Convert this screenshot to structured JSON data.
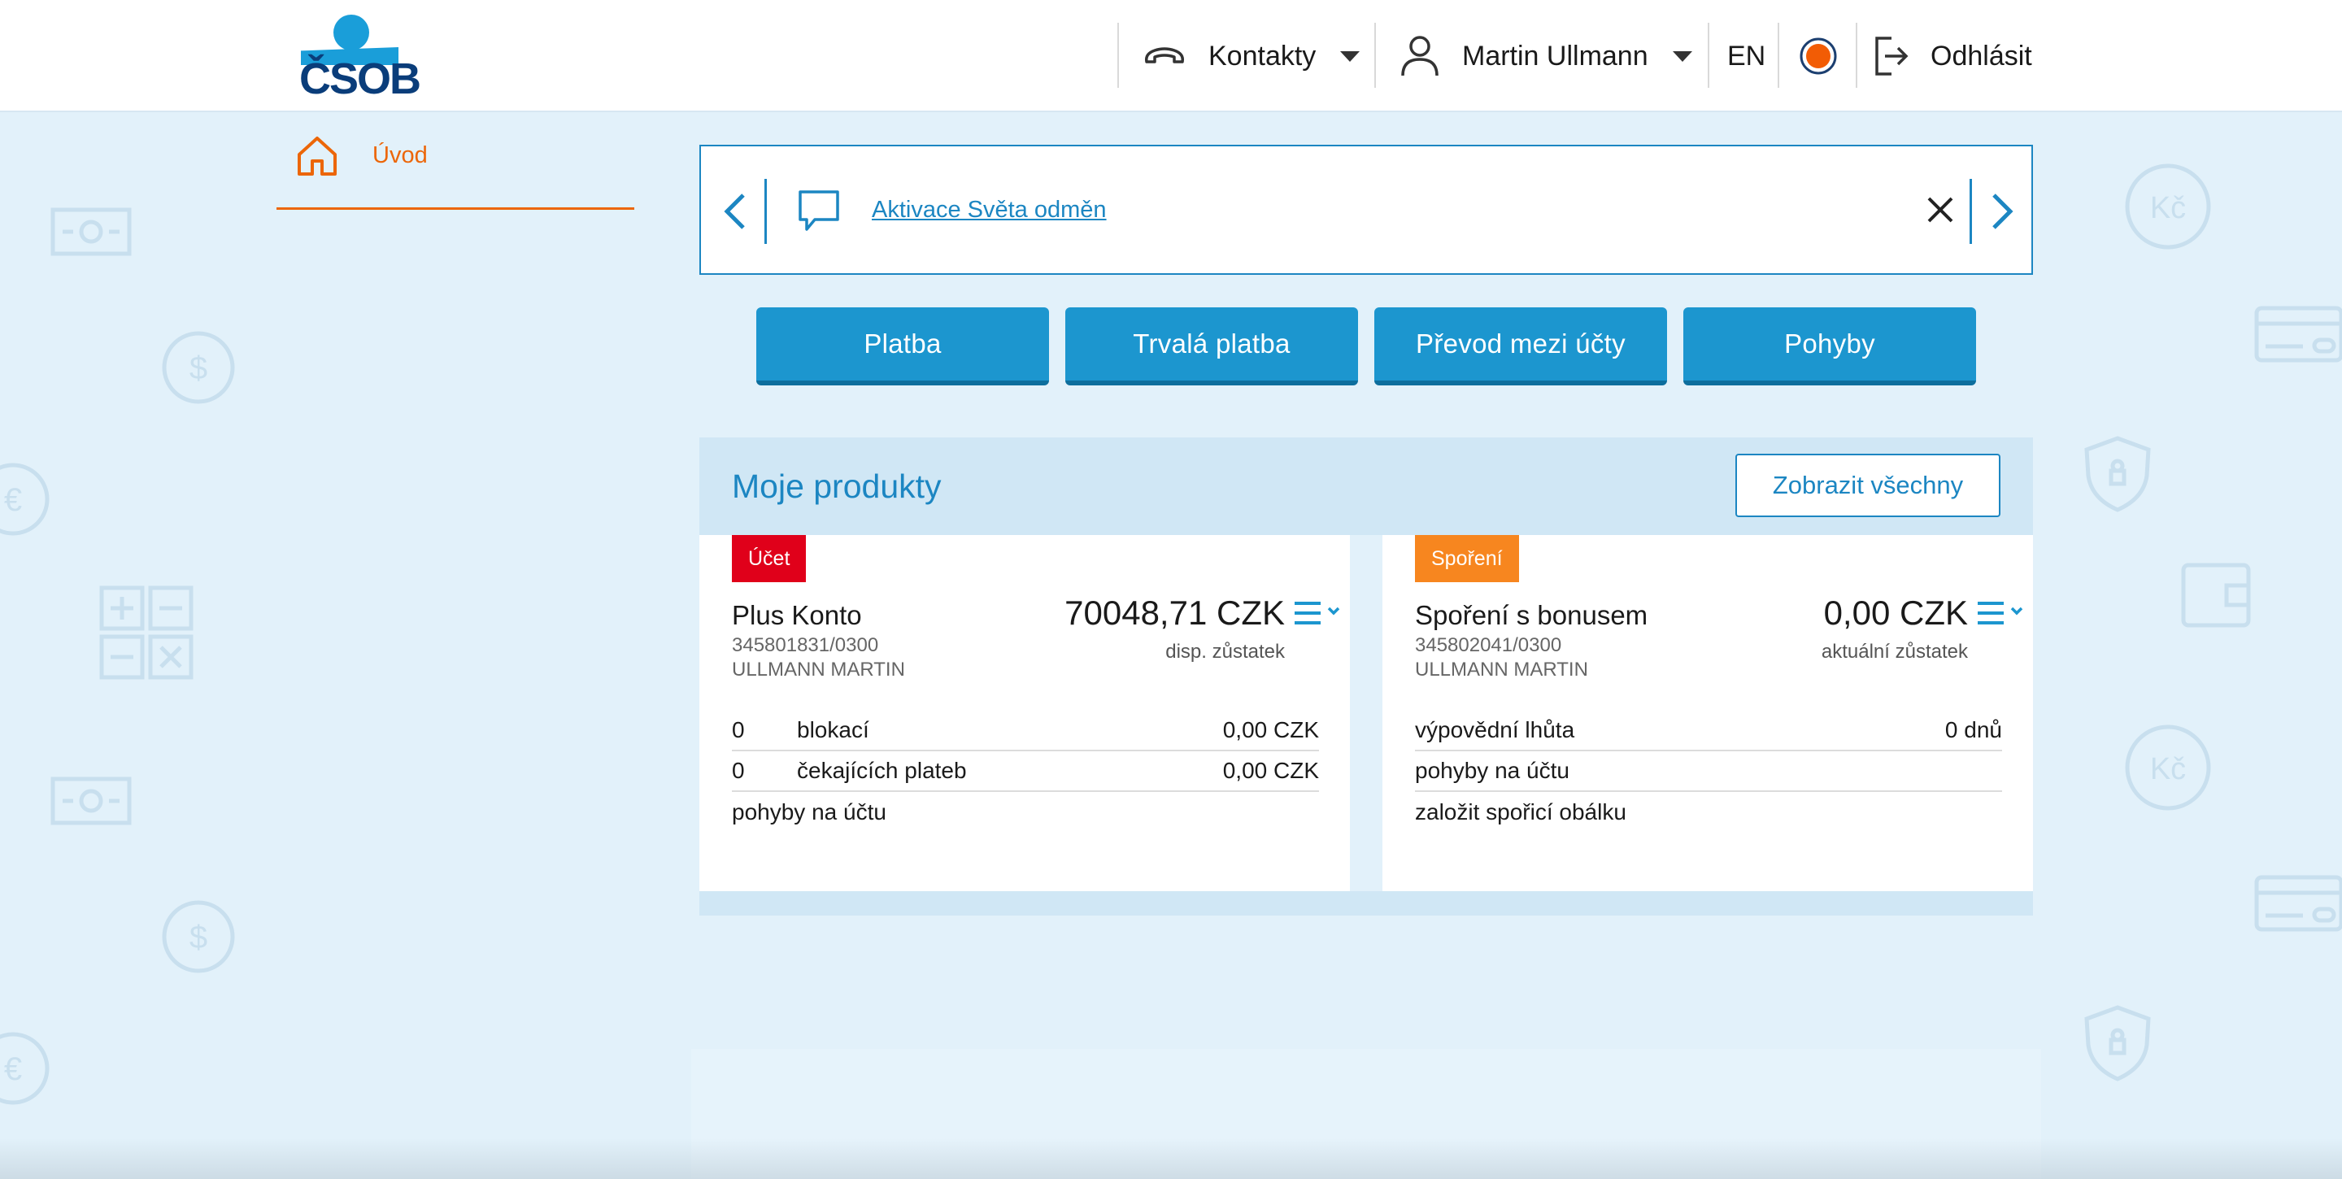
{
  "header": {
    "logo_text": "ČSOB",
    "contacts_label": "Kontakty",
    "user_name": "Martin Ullmann",
    "language": "EN",
    "logout_label": "Odhlásit"
  },
  "nav": {
    "home_label": "Úvod"
  },
  "notice": {
    "link_text": "Aktivace Světa odměn"
  },
  "actions": [
    {
      "label": "Platba"
    },
    {
      "label": "Trvalá platba"
    },
    {
      "label": "Převod mezi účty"
    },
    {
      "label": "Pohyby"
    }
  ],
  "products": {
    "title": "Moje produkty",
    "show_all_label": "Zobrazit všechny",
    "cards": [
      {
        "tag": "Účet",
        "tag_color": "#e0001a",
        "name": "Plus Konto",
        "number": "345801831/0300",
        "owner": "ULLMANN MARTIN",
        "amount": "70048,71 CZK",
        "amount_caption": "disp. zůstatek",
        "rows": [
          {
            "count": "0",
            "label": "blokací",
            "value": "0,00 CZK"
          },
          {
            "count": "0",
            "label": "čekajících plateb",
            "value": "0,00 CZK"
          },
          {
            "count": "",
            "label": "pohyby na účtu",
            "value": ""
          }
        ]
      },
      {
        "tag": "Spoření",
        "tag_color": "#f7861f",
        "name": "Spoření s bonusem",
        "number": "345802041/0300",
        "owner": "ULLMANN MARTIN",
        "amount": "0,00 CZK",
        "amount_caption": "aktuální zůstatek",
        "rows": [
          {
            "count": "",
            "label": "výpovědní lhůta",
            "value": "0 dnů"
          },
          {
            "count": "",
            "label": "pohyby na účtu",
            "value": ""
          },
          {
            "count": "",
            "label": "založit spořicí obálku",
            "value": ""
          }
        ]
      }
    ]
  },
  "colors": {
    "brand_blue": "#1c96cf",
    "accent_orange": "#ec6608",
    "status_dot": "#f25c05"
  }
}
